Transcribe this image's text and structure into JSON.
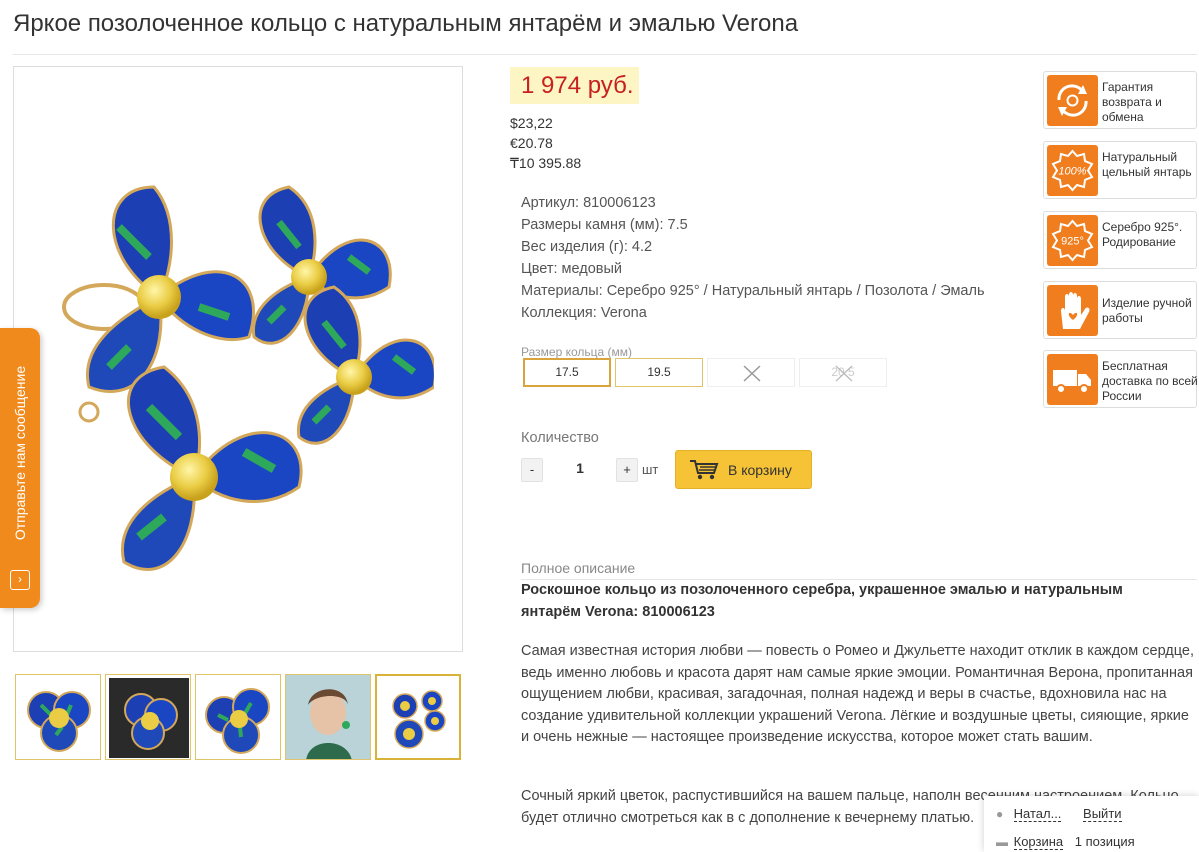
{
  "product": {
    "title": "Яркое позолоченное кольцо с натуральным янтарём и эмалью Verona",
    "price": "1 974 руб.",
    "alt_prices": [
      "$23,22",
      "€20.78",
      "₸10 395.88"
    ]
  },
  "specs": [
    "Артикул: 810006123",
    "Размеры камня (мм): 7.5",
    "Вес изделия (г): 4.2",
    "Цвет: медовый",
    "Материалы: Серебро 925° / Натуральный янтарь / Позолота / Эмаль",
    "Коллекция: Verona"
  ],
  "sizes": {
    "label": "Размер кольца (мм)",
    "options": [
      "17.5",
      "19.5",
      "",
      "20.5"
    ]
  },
  "quantity": {
    "label": "Количество",
    "minus": "-",
    "value": "1",
    "plus": "+",
    "unit": "шт"
  },
  "cart_button": {
    "label": "В корзину"
  },
  "description": {
    "label": "Полное описание",
    "heading": "Роскошное кольцо из позолоченного серебра, украшенное эмалью и натуральным янтарём Verona: 810006123",
    "p1": "Самая известная история любви — повесть о Ромео и Джульетте находит отклик в каждом сердце, ведь именно любовь и красота дарят нам самые яркие эмоции. Романтичная Верона, пропитанная ощущением любви, красивая, загадочная, полная надежд и веры в счастье, вдохновила нас на создание удивительной коллекции украшений Verona. Лёгкие и воздушные цветы, сияющие, яркие и очень нежные — настоящее произведение искусства, которое может стать вашим.",
    "p2": "Сочный яркий цветок, распустившийся на вашем пальце, наполн весенним настроением. Кольцо будет отлично смотреться как в с дополнение к вечернему платью."
  },
  "badges": [
    {
      "text": "Гарантия возврата и обмена",
      "icon": "refresh-icon",
      "badge_text": ""
    },
    {
      "text": "Натуральный цельный янтарь",
      "icon": "stamp-100-icon",
      "badge_text": "100%"
    },
    {
      "text": "Серебро 925°. Родирование",
      "icon": "stamp-925-icon",
      "badge_text": "925°"
    },
    {
      "text": "Изделие ручной работы",
      "icon": "hand-heart-icon",
      "badge_text": ""
    },
    {
      "text": "Бесплатная доставка по всей России",
      "icon": "truck-icon",
      "badge_text": ""
    }
  ],
  "feedback_tab": {
    "label": "Отправьте нам сообщение"
  },
  "user_panel": {
    "user": "Натал...",
    "logout": "Выйти",
    "cart": "Корзина",
    "cart_count": "1 позиция"
  },
  "colors": {
    "price_red": "#c8201e",
    "price_bg": "#fdf6c4",
    "accent_orange": "#f07e1e",
    "cart_yellow": "#f5c335",
    "size_border": "#e0c46a"
  }
}
